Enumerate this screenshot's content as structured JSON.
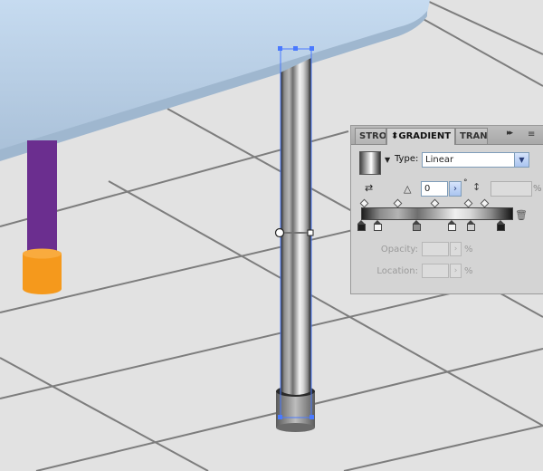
{
  "panel": {
    "tabs": [
      "STROKE",
      "GRADIENT",
      "TRANSPARENCY"
    ],
    "tab_arrows": "▸▸",
    "menu_icon": "≡",
    "active_tab_prefix": "⬍",
    "type_label": "Type:",
    "type_value": "Linear",
    "angle_value": "0",
    "degree_symbol": "°",
    "aspect_unit": "%",
    "opacity_label": "Opacity:",
    "location_label": "Location:",
    "percent": "%",
    "gradient_stops": 6,
    "midpoints": 5
  },
  "icons": {
    "reverse": "reverse-gradient-icon",
    "angle": "angle-icon",
    "aspect": "aspect-ratio-icon",
    "trash": "trash-icon"
  },
  "colors": {
    "floor": "#e2e2e2",
    "grid_line": "#7a7a7a",
    "table_top": "#c4d8ec",
    "leg_purple": "#6b2e8f",
    "foot_orange": "#f5991c",
    "selection": "#4a7aff"
  }
}
